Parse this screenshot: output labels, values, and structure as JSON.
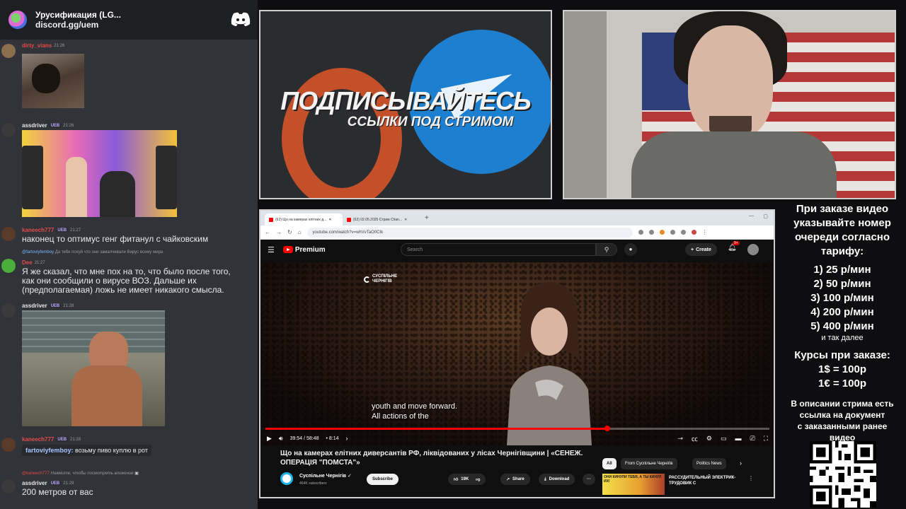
{
  "discord": {
    "server_name": "Урусификация (LG...",
    "invite": "discord.gg/uem",
    "messages": [
      {
        "user": "dirty_vians",
        "time": "21:26"
      },
      {
        "user": "assdriver",
        "badge": "UEB",
        "time": "21:26"
      },
      {
        "user": "kaneech777",
        "badge": "UEB",
        "time": "21:27",
        "text": "наконец то оптимус генг фитанул с чайковским"
      },
      {
        "reply_user": "@fartoviyfemboy",
        "reply_text": "Да тебе похуй что они замалчивали Вирус всему мира"
      },
      {
        "user": "Dee",
        "time": "21:27",
        "text_lines": [
          "Я же сказал, что мне пох на то, что было после того,",
          "как они сообщили о вирусе ВОЗ. Дальше их",
          "(предполагаемая) ложь не имеет никакого смысла."
        ]
      },
      {
        "user": "assdriver",
        "badge": "UEB",
        "time": "21:28"
      },
      {
        "user": "kaneech777",
        "badge": "UEB",
        "time": "21:28",
        "mention_user": "fartoviyfemboy:",
        "mention_text": "возьму пиво куплю в рот"
      },
      {
        "reply_user": "@kaneech777",
        "reply_text": "Нажмите, чтобы посмотреть вложение"
      },
      {
        "user": "assdriver",
        "badge": "UEB",
        "time": "21:29",
        "text": "200 метров от вас"
      }
    ]
  },
  "promo": {
    "title": "ПОДПИСЫВАЙТЕСЬ",
    "subtitle": "ССЫЛКИ ПОД СТРИМОМ",
    "colors": {
      "orange": "#c4502a",
      "blue": "#1c7fd0"
    }
  },
  "browser": {
    "tabs": [
      {
        "label": "(62) Що на камерах елітних д..."
      },
      {
        "label": "(62) 02.05.2025 Стрим Chan..."
      }
    ],
    "url": "youtube.com/watch?v=whVvTaO0CIk",
    "youtube": {
      "logo": "Premium",
      "search_placeholder": "Search",
      "create_label": "Create",
      "notification_count": "9+",
      "channel_watermark_line1": "СУСПІЛЬНЕ",
      "channel_watermark_line2": "ЧЕРНІГІВ",
      "subtitle_line1": "youth and move forward.",
      "subtitle_line2": "All actions of the",
      "time_display": "39:54 / 58:48",
      "chapter": "• 8:14",
      "progress_percent": 67.8,
      "video_title": "Що на камерах елітних диверсантів РФ, ліквідованих у лісах Чернігівщини | «СЕНЕЖ. ОПЕРАЦІЯ \"ПОМСТА\"»",
      "channel_name": "Суспільне Чернігів",
      "subscribers": "464K subscribers",
      "subscribe_label": "Subscribe",
      "likes": "19K",
      "share_label": "Share",
      "download_label": "Download",
      "chips": [
        "All",
        "From Суспільне Чернігів",
        "Politics News"
      ],
      "rec_thumb_text": "ОНИ КИНУЛИ ТЕБЯ, А ТЫ КИНУЛ ИХ!",
      "rec_title": "РАССУДИТЕЛЬНЫЙ ЭЛЕКТРИК-ТРУДОВИК С"
    }
  },
  "info": {
    "heading_lines": [
      "При заказе видео",
      "указывайте номер",
      "очереди согласно",
      "тарифу:"
    ],
    "tariffs": [
      "1) 25 р/мин",
      "2) 50 р/мин",
      "3) 100 р/мин",
      "4) 200 р/мин",
      "5) 400 р/мин"
    ],
    "etc": "и так далее",
    "rates_title": "Курсы при заказе:",
    "rates": [
      "1$ = 100р",
      "1€ = 100р"
    ],
    "doc_lines": [
      "В описании стрима есть",
      "ссылка на документ",
      "с заказанными ранее",
      "видео"
    ]
  }
}
